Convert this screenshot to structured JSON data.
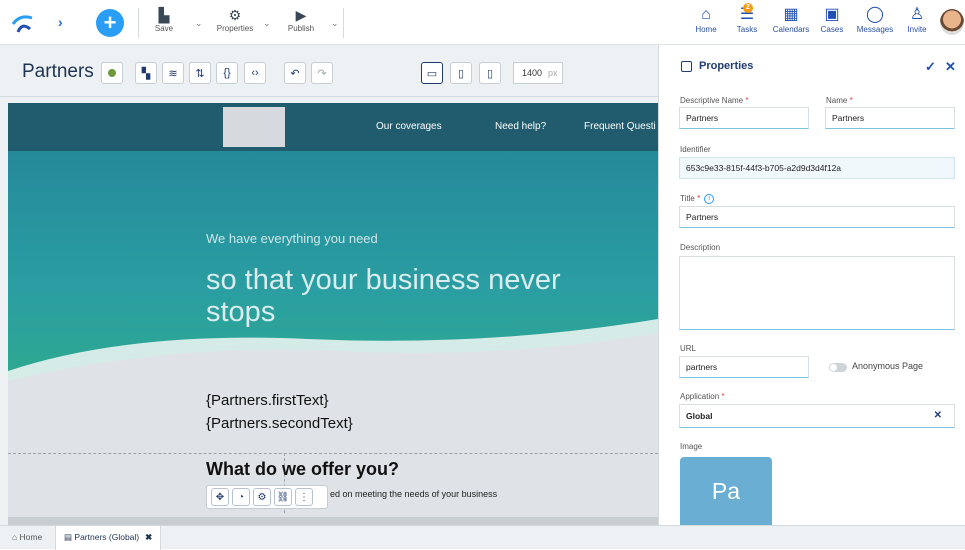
{
  "toolbar": {
    "save_label": "Save",
    "properties_label": "Properties",
    "publish_label": "Publish"
  },
  "topnav": {
    "home": "Home",
    "tasks": "Tasks",
    "tasks_badge": "2",
    "calendars": "Calendars",
    "cases": "Cases",
    "messages": "Messages",
    "invite": "Invite"
  },
  "editor": {
    "title": "Partners",
    "width_value": "1400",
    "width_unit": "px"
  },
  "preview": {
    "nav_links": [
      "Our coverages",
      "Need help?",
      "Frequent Questi"
    ],
    "hero_sub": "We have everything you need",
    "hero_big": "so that your business never stops",
    "template_first": "{Partners.firstText}",
    "template_second": "{Partners.secondText}",
    "offer_title": "What do we offer you?",
    "offer_sub": "ed on meeting the needs of your business"
  },
  "properties": {
    "title": "Properties",
    "descriptive_name_label": "Descriptive Name",
    "descriptive_name_value": "Partners",
    "name_label": "Name",
    "name_value": "Partners",
    "identifier_label": "Identifier",
    "identifier_value": "653c9e33-815f-44f3-b705-a2d9d3d4f12a",
    "title_label": "Title",
    "title_value": "Partners",
    "description_label": "Description",
    "description_value": "",
    "url_label": "URL",
    "url_value": "partners",
    "anonymous_label": "Anonymous Page",
    "application_label": "Application",
    "application_value": "Global",
    "image_label": "Image",
    "image_initials": "Pa"
  },
  "tabs": {
    "home": "Home",
    "partners": "Partners (Global)"
  },
  "colors": {
    "accent": "#2a9df4",
    "nav_text": "#1f4fb0",
    "hero_dark": "#205c6e",
    "hero_teal": "#2a9ea2"
  }
}
